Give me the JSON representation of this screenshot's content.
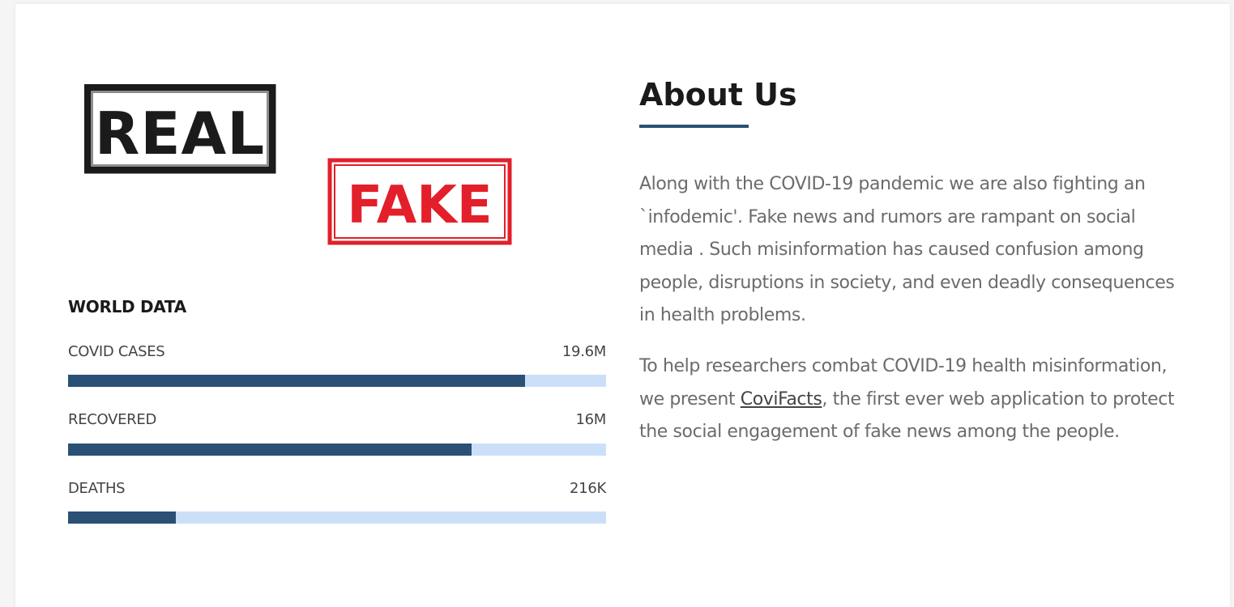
{
  "stamps": {
    "real": "REAL",
    "fake": "FAKE"
  },
  "world": {
    "title": "WORLD DATA",
    "stats": [
      {
        "label": "COVID CASES",
        "value": "19.6M",
        "fill_fraction": 0.85
      },
      {
        "label": "RECOVERED",
        "value": "16M",
        "fill_fraction": 0.75
      },
      {
        "label": "DEATHS",
        "value": "216K",
        "fill_fraction": 0.2
      }
    ]
  },
  "about": {
    "title": "About Us",
    "paragraph1": "Along with the COVID-19 pandemic we are also fighting an `infodemic'. Fake news and rumors are rampant on social media . Such misinformation has caused confusion among people, disruptions in society, and even deadly consequences in health problems.",
    "paragraph2_before": "To help researchers combat COVID-19 health misinformation, we present ",
    "paragraph2_link": "CoviFacts",
    "paragraph2_after": ", the first ever web application to protect the social engagement of fake news among the people."
  },
  "colors": {
    "bar_fill": "#2a5075",
    "bar_track": "#cbe0f8",
    "accent": "#2a5075",
    "fake_red": "#e21f2a"
  }
}
